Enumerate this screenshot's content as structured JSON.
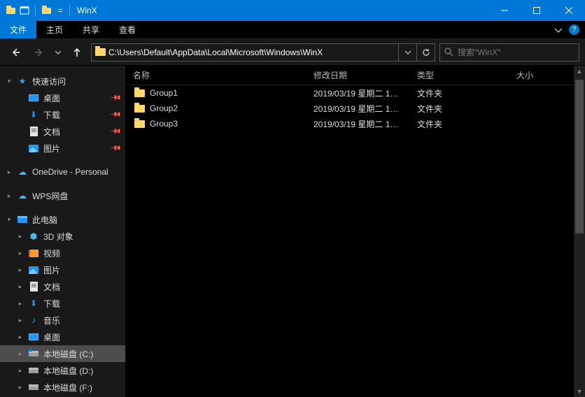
{
  "titlebar": {
    "title": "WinX"
  },
  "ribbon": {
    "file": "文件",
    "tabs": [
      "主页",
      "共享",
      "查看"
    ]
  },
  "nav": {
    "path": "C:\\Users\\Default\\AppData\\Local\\Microsoft\\Windows\\WinX",
    "search_placeholder": "搜索\"WinX\""
  },
  "sidebar": {
    "quick_access": "快速访问",
    "quick_items": [
      {
        "label": "桌面",
        "icon": "desktop",
        "pinned": true
      },
      {
        "label": "下载",
        "icon": "download",
        "pinned": true
      },
      {
        "label": "文档",
        "icon": "doc",
        "pinned": true
      },
      {
        "label": "图片",
        "icon": "pic",
        "pinned": true
      }
    ],
    "onedrive": "OneDrive - Personal",
    "wps": "WPS网盘",
    "this_pc": "此电脑",
    "pc_items": [
      {
        "label": "3D 对象",
        "icon": "3d"
      },
      {
        "label": "视频",
        "icon": "video"
      },
      {
        "label": "图片",
        "icon": "pic"
      },
      {
        "label": "文档",
        "icon": "doc"
      },
      {
        "label": "下载",
        "icon": "download"
      },
      {
        "label": "音乐",
        "icon": "music"
      },
      {
        "label": "桌面",
        "icon": "desktop"
      },
      {
        "label": "本地磁盘 (C:)",
        "icon": "drive-c",
        "selected": true
      },
      {
        "label": "本地磁盘 (D:)",
        "icon": "drive"
      },
      {
        "label": "本地磁盘 (F:)",
        "icon": "drive"
      }
    ]
  },
  "columns": {
    "name": "名称",
    "date": "修改日期",
    "type": "类型",
    "size": "大小"
  },
  "rows": [
    {
      "name": "Group1",
      "date": "2019/03/19 星期二 1…",
      "type": "文件夹",
      "size": ""
    },
    {
      "name": "Group2",
      "date": "2019/03/19 星期二 1…",
      "type": "文件夹",
      "size": ""
    },
    {
      "name": "Group3",
      "date": "2019/03/19 星期二 1…",
      "type": "文件夹",
      "size": ""
    }
  ]
}
